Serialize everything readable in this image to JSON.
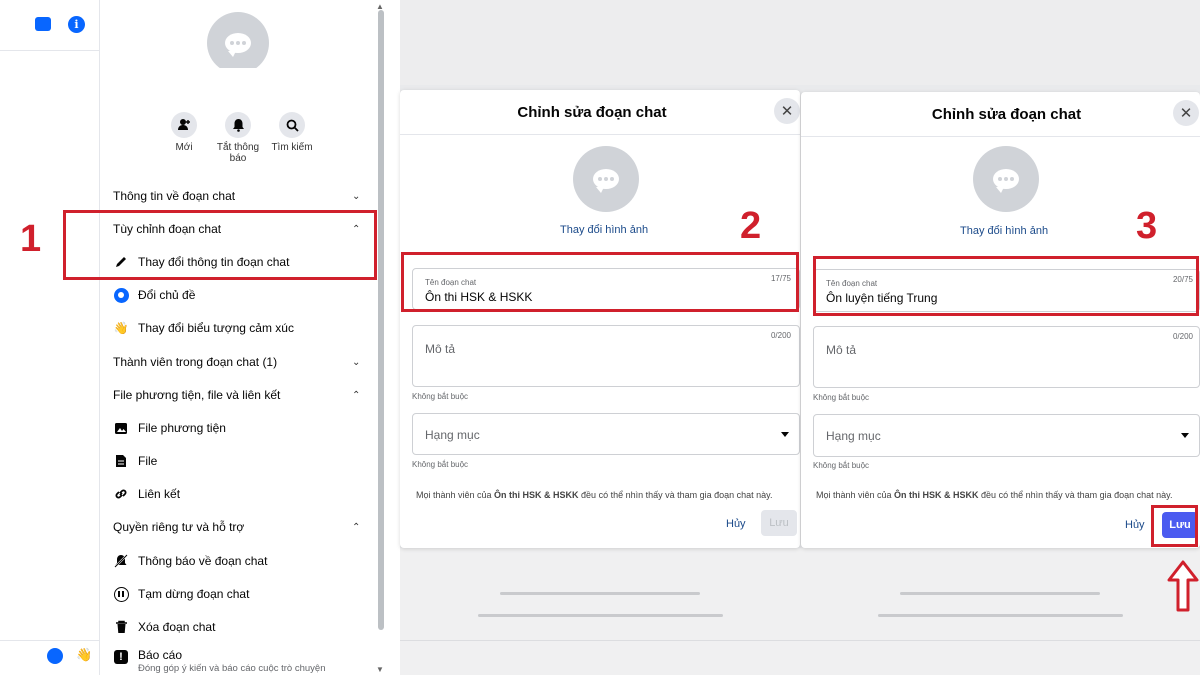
{
  "panel1": {
    "actions": [
      {
        "label": "Mới",
        "icon": "add-person-icon"
      },
      {
        "label": "Tắt thông\nbáo",
        "icon": "bell-icon"
      },
      {
        "label": "Tìm kiếm",
        "icon": "search-icon"
      }
    ],
    "sections": [
      {
        "label": "Thông tin về đoạn chat",
        "expanded": false
      },
      {
        "label": "Tùy chỉnh đoạn chat",
        "expanded": true
      },
      {
        "label": "Thành viên trong đoạn chat (1)",
        "expanded": false
      },
      {
        "label": "File phương tiện, file và liên kết",
        "expanded": true
      },
      {
        "label": "Quyền riêng tư và hỗ trợ",
        "expanded": true
      }
    ],
    "items": {
      "change_info": "Thay đổi thông tin đoạn chat",
      "change_theme": "Đổi chủ đề",
      "change_emoji": "Thay đổi biểu tượng cảm xúc",
      "media": "File phương tiện",
      "file": "File",
      "link": "Liên kết",
      "notifications": "Thông báo về đoạn chat",
      "pause": "Tạm dừng đoạn chat",
      "delete": "Xóa đoạn chat",
      "report": "Báo cáo",
      "report_sub": "Đóng góp ý kiến và báo cáo cuộc trò chuyện"
    }
  },
  "dialog2": {
    "title": "Chỉnh sửa đoạn chat",
    "change_image": "Thay đổi hình ảnh",
    "name_label": "Tên đoạn chat",
    "name_value": "Ôn thi HSK & HSKK",
    "name_counter": "17/75",
    "desc_placeholder": "Mô tả",
    "desc_counter": "0/200",
    "optional": "Không bắt buộc",
    "category_placeholder": "Hạng mục",
    "notice_pre": "Mọi thành viên của ",
    "notice_name": "Ôn thi HSK & HSKK",
    "notice_post": " đều có thể nhìn thấy và tham gia đoạn chat này.",
    "cancel": "Hủy",
    "save": "Lưu"
  },
  "dialog3": {
    "title": "Chỉnh sửa đoạn chat",
    "change_image": "Thay đổi hình ảnh",
    "name_label": "Tên đoạn chat",
    "name_value": "Ôn luyện tiếng Trung",
    "name_counter": "20/75",
    "desc_placeholder": "Mô tả",
    "desc_counter": "0/200",
    "optional": "Không bắt buộc",
    "category_placeholder": "Hạng mục",
    "notice_pre": "Mọi thành viên của ",
    "notice_name": "Ôn thi HSK & HSKK",
    "notice_post": " đều có thể nhìn thấy và tham gia đoạn chat này.",
    "cancel": "Hủy",
    "save": "Lưu"
  },
  "steps": [
    "1",
    "2",
    "3"
  ],
  "colors": {
    "annotation_red": "#d0202c",
    "messenger_blue": "#0866ff",
    "save_active": "#4b5bf0",
    "save_disabled": "#e4e6eb"
  }
}
